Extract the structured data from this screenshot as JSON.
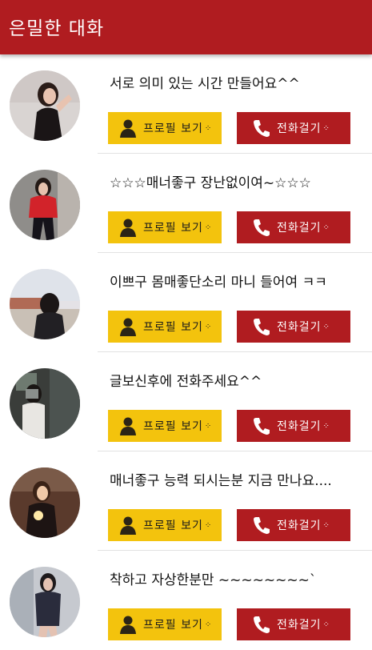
{
  "appbar": {
    "title": "은밀한 대화"
  },
  "buttons": {
    "profile_label": "프로필 보기",
    "call_label": "전화걸기",
    "dots": "⁘"
  },
  "colors": {
    "primary_red": "#b01c20",
    "profile_yellow": "#f3c30d"
  },
  "items": [
    {
      "message": "서로 의미 있는 시간 만들어요^^"
    },
    {
      "message": "☆☆☆매너좋구 장난없이여~☆☆☆"
    },
    {
      "message": "이쁘구 몸매좋단소리 마니 들어여 ㅋㅋ"
    },
    {
      "message": "글보신후에 전화주세요^^"
    },
    {
      "message": "매너좋구 능력 되시는분 지금 만나요...."
    },
    {
      "message": "착하고 자상한분만 ~~~~~~~~`"
    }
  ]
}
